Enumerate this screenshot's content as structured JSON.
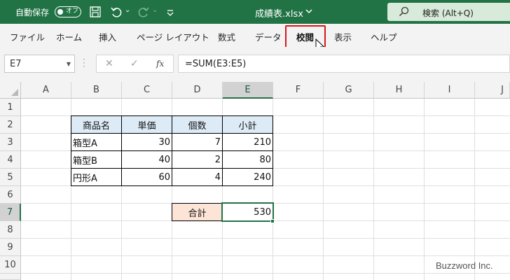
{
  "titlebar": {
    "autosave_label": "自動保存",
    "autosave_state": "オフ",
    "filename": "成績表.xlsx",
    "search_label": "検索 (Alt+Q)"
  },
  "tabs": [
    "ファイル",
    "ホーム",
    "挿入",
    "ページ レイアウト",
    "数式",
    "データ",
    "校閲",
    "表示",
    "ヘルプ"
  ],
  "active_tab": "校閲",
  "formula_bar": {
    "name_box": "E7",
    "formula": "=SUM(E3:E5)",
    "fx_label": "fx"
  },
  "columns": [
    "A",
    "B",
    "C",
    "D",
    "E",
    "F",
    "G",
    "H",
    "I",
    "J"
  ],
  "rows": [
    "1",
    "2",
    "3",
    "4",
    "5",
    "6",
    "7",
    "8",
    "9",
    "10"
  ],
  "table": {
    "headers": [
      "商品名",
      "単価",
      "個数",
      "小計"
    ],
    "rows": [
      [
        "箱型A",
        "30",
        "7",
        "210"
      ],
      [
        "箱型B",
        "40",
        "2",
        "80"
      ],
      [
        "円形A",
        "60",
        "4",
        "240"
      ]
    ],
    "total_label": "合計",
    "total_value": "530"
  },
  "watermark": "Buzzword Inc.",
  "colors": {
    "brand_green": "#217346",
    "header_fill": "#ddebf7",
    "total_fill": "#fce4d6",
    "highlight_red": "#d9161b"
  }
}
